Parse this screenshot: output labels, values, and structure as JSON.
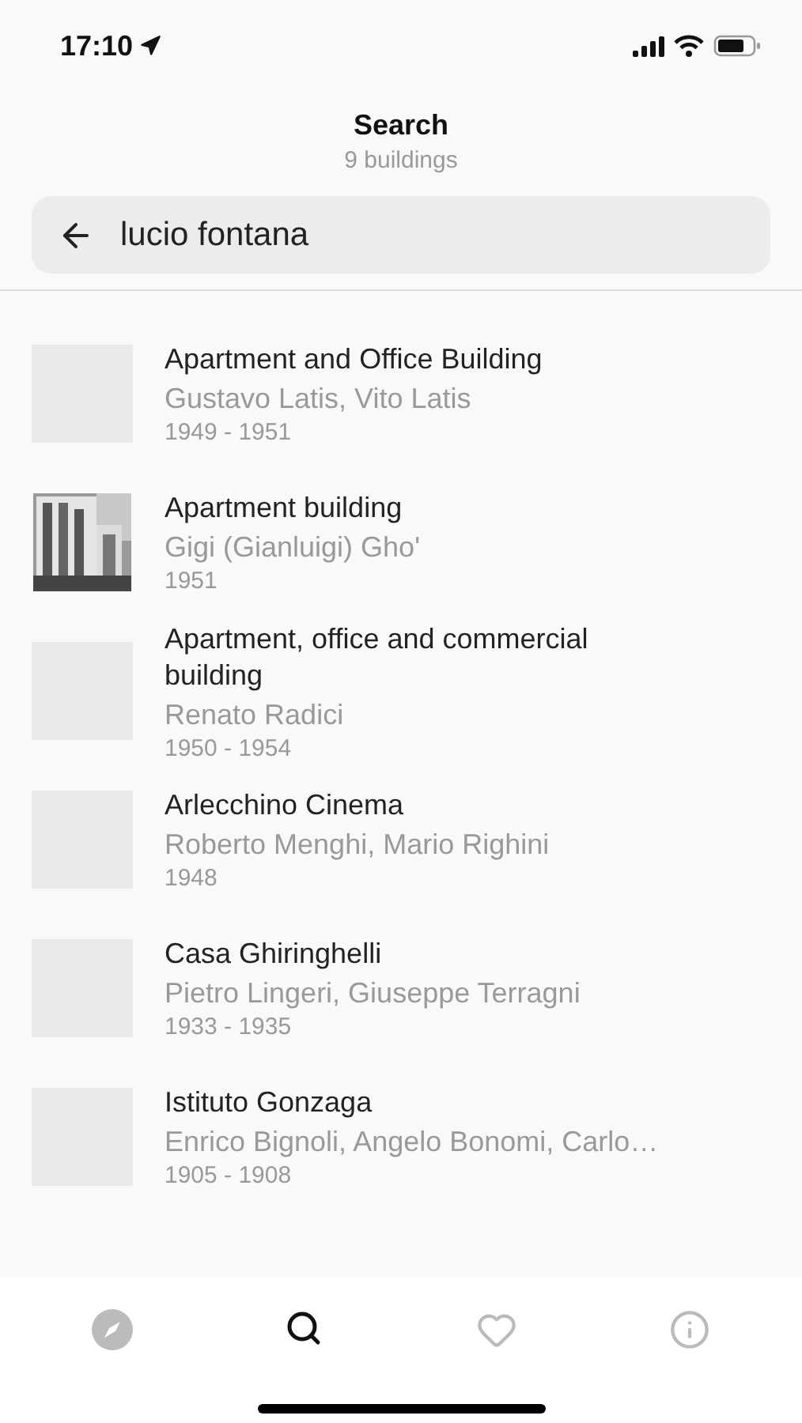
{
  "status_bar": {
    "time": "17:10"
  },
  "header": {
    "title": "Search",
    "subtitle": "9 buildings"
  },
  "search": {
    "value": "lucio fontana"
  },
  "results": [
    {
      "title": "Apartment and Office Building",
      "architects": "Gustavo Latis, Vito Latis",
      "years": "1949 - 1951",
      "kind": "empty"
    },
    {
      "title": "Apartment building",
      "architects": "Gigi (Gianluigi) Gho'",
      "years": "1951",
      "kind": "picture"
    },
    {
      "title": "Apartment, office and commercial building",
      "architects": "Renato Radici",
      "years": "1950 - 1954",
      "kind": "empty"
    },
    {
      "title": "Arlecchino Cinema",
      "architects": "Roberto Menghi, Mario Righini",
      "years": "1948",
      "kind": "empty"
    },
    {
      "title": "Casa Ghiringhelli",
      "architects": "Pietro Lingeri, Giuseppe Terragni",
      "years": "1933 - 1935",
      "kind": "empty"
    },
    {
      "title": "Istituto Gonzaga",
      "architects": "Enrico Bignoli, Angelo Bonomi, Carlo…",
      "years": "1905 - 1908",
      "kind": "empty"
    }
  ],
  "tabs": [
    {
      "kind": "compass",
      "selected": false
    },
    {
      "kind": "search",
      "selected": true
    },
    {
      "kind": "heart",
      "selected": false
    },
    {
      "kind": "info",
      "selected": false
    }
  ]
}
